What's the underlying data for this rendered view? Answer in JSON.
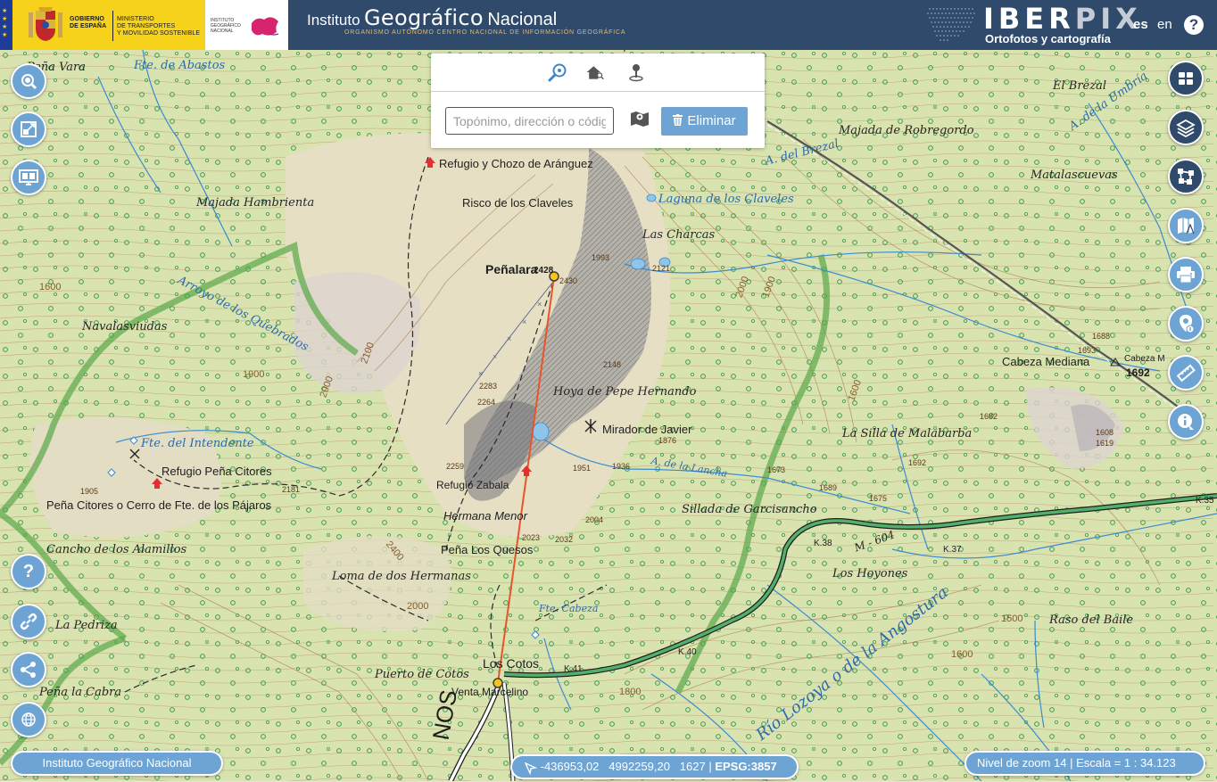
{
  "header": {
    "gov_line1": "GOBIERNO",
    "gov_line2": "DE ESPAÑA",
    "ministry_line1": "MINISTERIO",
    "ministry_line2": "DE TRANSPORTES",
    "ministry_line3": "Y MOVILIDAD SOSTENIBLE",
    "ign_small_1": "INSTITUTO",
    "ign_small_2": "GEOGRÁFICO",
    "ign_small_3": "NACIONAL",
    "title_word1": "Instituto",
    "title_word2": "Geográfico",
    "title_word3": "Nacional",
    "subtitle": "ORGANISMO AUTÓNOMO  CENTRO NACIONAL DE INFORMACIÓN GEOGRÁFICA",
    "app_name_a": "IBER",
    "app_name_b": "PIX",
    "app_subtitle": "Ortofotos y cartografía",
    "lang_es": "es",
    "lang_en": "en",
    "help": "?"
  },
  "search": {
    "tabs": [
      "search-place-icon",
      "search-address-icon",
      "search-coordinates-icon"
    ],
    "placeholder": "Topónimo, dirección o código",
    "delete_label": "Eliminar"
  },
  "left_buttons": [
    "search-icon",
    "extent-icon",
    "monitor-icon"
  ],
  "left_bottom_buttons": [
    "help-icon",
    "link-icon",
    "share-icon",
    "globe-icon"
  ],
  "right_buttons": [
    "grid-icon",
    "layers-icon",
    "draw-icon",
    "map-book-icon",
    "print-icon",
    "location-info-icon",
    "ruler-icon",
    "info-icon"
  ],
  "footer": {
    "attribution": "Instituto Geográfico Nacional",
    "coords_x": "-436953,02",
    "coords_y": "4992259,20",
    "elevation": "1627",
    "epsg": "EPSG:3857",
    "zoom_label": "Nivel de zoom",
    "zoom_value": "14",
    "scale_label": "Escala = 1 : 34.123"
  },
  "map_labels": {
    "penalara": "Peñalara",
    "penalara_elev": "2428",
    "penalara_elev_small": "2430",
    "refugio_aranguez": "Refugio y Chozo de Aránguez",
    "risco_claveles": "Risco de los Claveles",
    "laguna_claveles": "Laguna de los Claveles",
    "las_charcas": "Las Charcas",
    "majada_hambrienta": "Majada Hambrienta",
    "navalasviudas": "Navalasviudas",
    "los_quebrados": "Arroyo de los Quebrados",
    "hoya_pepe": "Hoya de Pepe Hernando",
    "mirador_javier": "Mirador de Javier",
    "fte_intendente": "Fte. del Intendente",
    "refugio_citores": "Refugio Peña Citores",
    "pena_citores": "Peña Citores o Cerro de Fte. de los Pájaros",
    "refugio_zabala": "Refugio Zabala",
    "hermana_menor": "Hermana Menor",
    "pena_quesos": "Peña Los Quesos",
    "cancho_alamillos": "Cancho de los Alamillos",
    "loma_hermanas": "Loma de dos Hermanas",
    "los_cotos": "Los Cotos",
    "puerto_cotos": "Puerto de Cotos",
    "venta_marcelino": "Venta Marcelino",
    "pena_cabra": "Peña la Cabra",
    "la_pedriza": "La Pedriza",
    "fte_cabeza": "Fte. Cabeza",
    "el_brezal": "El Brezal",
    "majada_robregordo": "Majada de Robregordo",
    "matalascuevas": "Matalascuevas",
    "a_brezal": "A. del Brezal",
    "cabeza_mediana": "Cabeza Mediana",
    "cabeza_m_elev": "1692",
    "cabeza_m_short": "Cabeza M",
    "silla_malabarba": "La Silla de Malabarba",
    "sillada_garcisancho": "Sillada de Garcisancho",
    "los_hoyones": "Los Hoyones",
    "raso_baile": "Raso del Baile",
    "rio_lozoya": "Río Lozoya o de la Angostura",
    "road_m604": "M - 604",
    "pena_vara": "Peña Vara",
    "fte_abastos": "Fte. de Abastos",
    "arroyo_lancha": "A. de la Lancha",
    "a_umbria": "A. de la Umbría",
    "nos": "NOS",
    "k38": "K.38",
    "k37": "K.37",
    "k41": "K.41",
    "k40": "K.40",
    "k35": "K.35",
    "e2121": "2121",
    "e2148": "2148",
    "e2283": "2283",
    "e2264": "2264",
    "e2259": "2259",
    "e1951": "1951",
    "e1936": "1936",
    "e2181": "2181",
    "e1905": "1905",
    "e2004": "2004",
    "e2023": "2023",
    "e2032": "2032",
    "e1876": "1876",
    "e1993": "1993",
    "e1688": "1688",
    "e1693": "1693",
    "e1682": "1682",
    "e1608": "1608",
    "e1619": "1619",
    "e1673": "1673",
    "e1689": "1689",
    "e1675": "1675",
    "e1692b": "1692",
    "c1600": "1600",
    "c1900": "1900",
    "c2000": "2000",
    "c2100": "2100",
    "c1800": "1800",
    "c1500": "1500",
    "c2400": "2400"
  }
}
